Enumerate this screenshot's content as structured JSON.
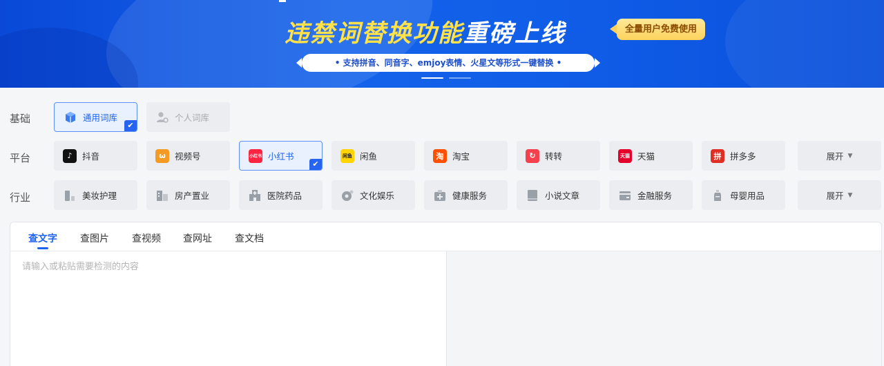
{
  "banner": {
    "title_part1": "违禁词替换功能",
    "title_part2": "重磅上线",
    "badge": "全量用户免费使用",
    "subtitle": "• 支持拼音、同音字、emjoy表情、火星文等形式一键替换 •"
  },
  "rows": {
    "basic": {
      "label": "基础",
      "items": [
        {
          "label": "通用词库",
          "icon": "cube-icon",
          "selected": true
        },
        {
          "label": "个人词库",
          "icon": "user-settings-icon",
          "selected": false
        }
      ]
    },
    "platform": {
      "label": "平台",
      "items": [
        {
          "label": "抖音",
          "icon": "douyin-icon",
          "icon_text": "♪",
          "color": "#111111"
        },
        {
          "label": "视频号",
          "icon": "channels-icon",
          "icon_text": "ω",
          "color": "#f59a23"
        },
        {
          "label": "小红书",
          "icon": "xiaohongshu-icon",
          "icon_text": "小红书",
          "color": "#ff2442",
          "selected": true
        },
        {
          "label": "闲鱼",
          "icon": "xianyu-icon",
          "icon_text": "闲鱼",
          "color": "#ffd400"
        },
        {
          "label": "淘宝",
          "icon": "taobao-icon",
          "icon_text": "淘",
          "color": "#ff5000"
        },
        {
          "label": "转转",
          "icon": "zhuanzhuan-icon",
          "icon_text": "↻",
          "color": "#f5414e"
        },
        {
          "label": "天猫",
          "icon": "tmall-icon",
          "icon_text": "天猫",
          "color": "#e4002b"
        },
        {
          "label": "拼多多",
          "icon": "pinduoduo-icon",
          "icon_text": "拼",
          "color": "#e02e24"
        }
      ],
      "expand": "展开"
    },
    "industry": {
      "label": "行业",
      "items": [
        {
          "label": "美妆护理",
          "icon": "cosmetics-icon"
        },
        {
          "label": "房产置业",
          "icon": "building-icon"
        },
        {
          "label": "医院药品",
          "icon": "hospital-icon"
        },
        {
          "label": "文化娱乐",
          "icon": "culture-icon"
        },
        {
          "label": "健康服务",
          "icon": "health-icon"
        },
        {
          "label": "小说文章",
          "icon": "book-icon"
        },
        {
          "label": "金融服务",
          "icon": "wallet-icon"
        },
        {
          "label": "母婴用品",
          "icon": "bottle-icon"
        }
      ],
      "expand": "展开"
    }
  },
  "tabs": [
    "查文字",
    "查图片",
    "查视频",
    "查网址",
    "查文档"
  ],
  "input": {
    "placeholder": "请输入或粘贴需要检测的内容",
    "value": ""
  },
  "colors": {
    "accent": "#1e63ee",
    "banner_bg": "#1463ea",
    "banner_yellow": "#ffe14a"
  }
}
